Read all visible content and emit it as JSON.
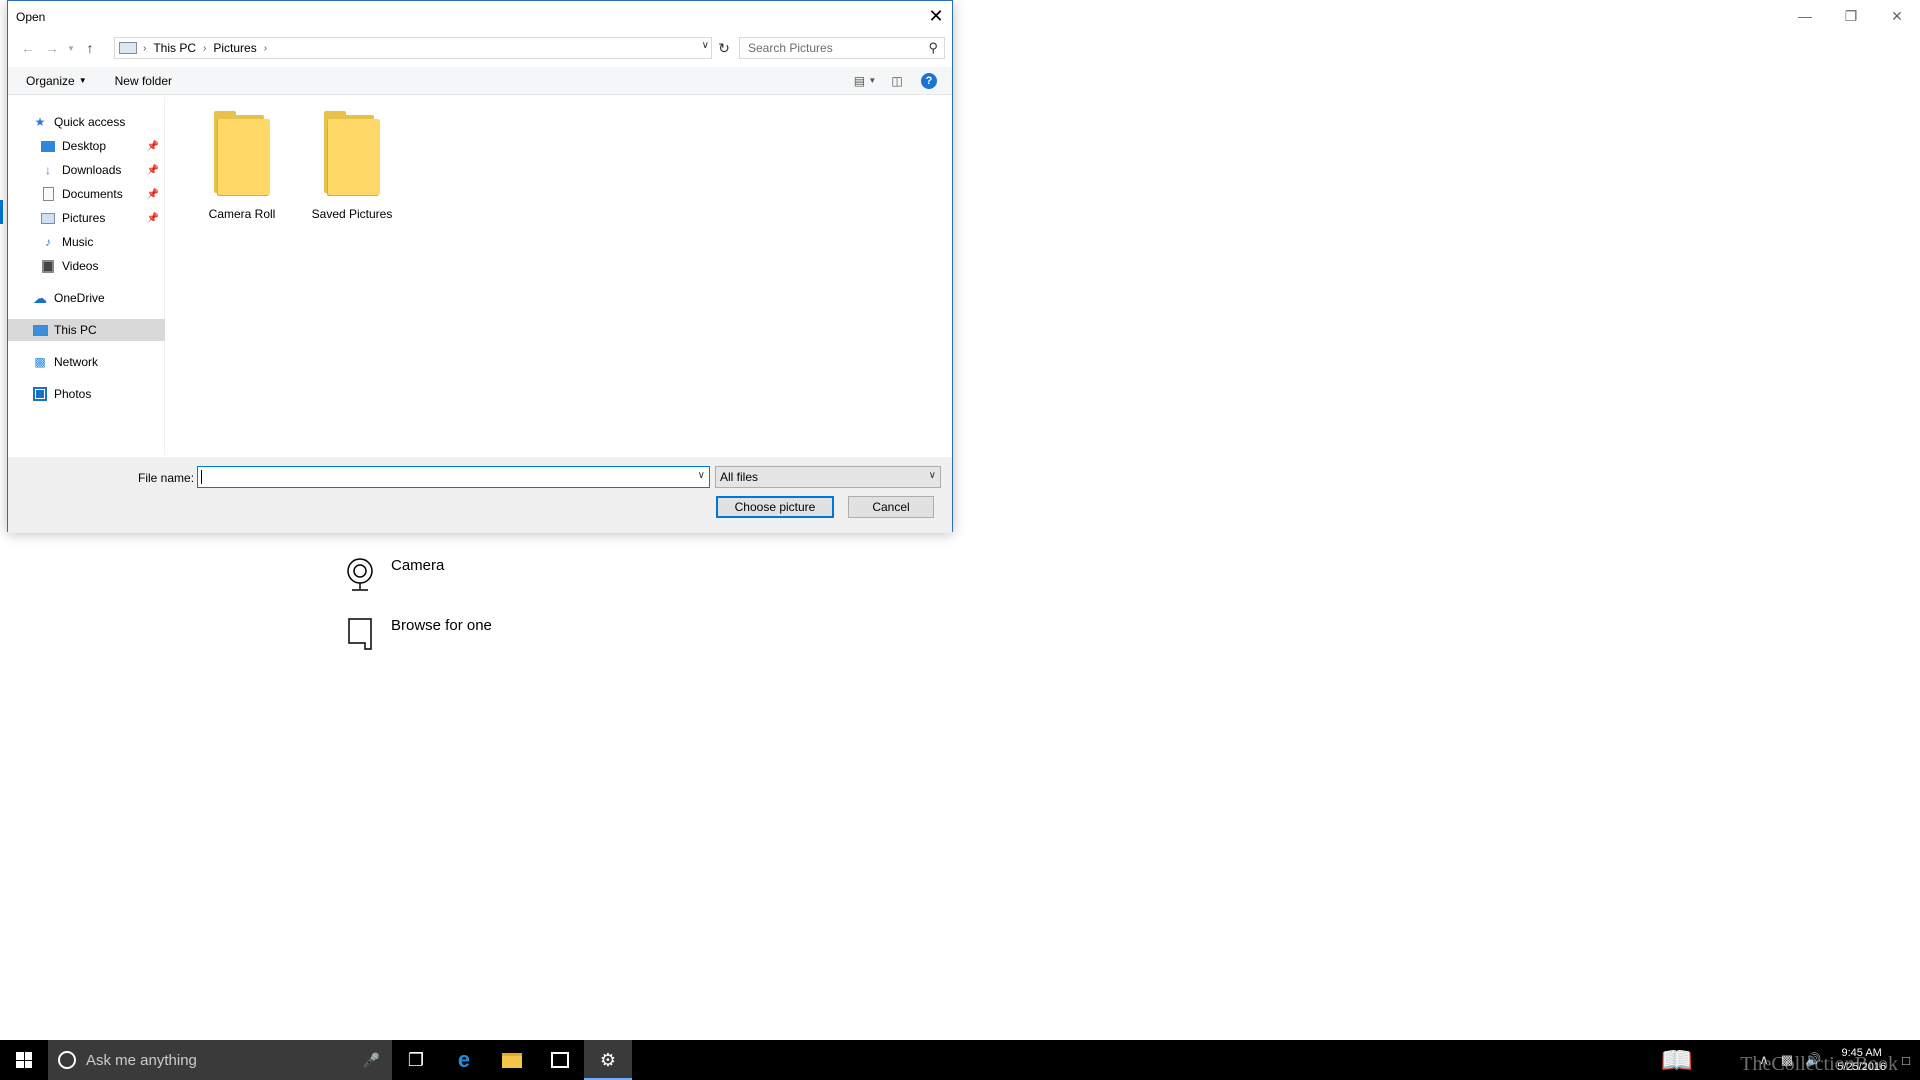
{
  "background_window": {
    "options": [
      {
        "label": "Camera",
        "icon": "camera-icon"
      },
      {
        "label": "Browse for one",
        "icon": "file-icon"
      }
    ]
  },
  "dialog": {
    "title": "Open",
    "address": {
      "crumbs": [
        "This PC",
        "Pictures"
      ]
    },
    "search_placeholder": "Search Pictures",
    "toolbar": {
      "organize": "Organize",
      "new_folder": "New folder",
      "help": "?"
    },
    "nav": {
      "quick_access": "Quick access",
      "quick_items": [
        {
          "label": "Desktop",
          "pinned": true
        },
        {
          "label": "Downloads",
          "pinned": true
        },
        {
          "label": "Documents",
          "pinned": true
        },
        {
          "label": "Pictures",
          "pinned": true
        },
        {
          "label": "Music",
          "pinned": false
        },
        {
          "label": "Videos",
          "pinned": false
        }
      ],
      "onedrive": "OneDrive",
      "this_pc": "This PC",
      "network": "Network",
      "photos": "Photos"
    },
    "folders": [
      {
        "name": "Camera Roll"
      },
      {
        "name": "Saved Pictures"
      }
    ],
    "file_name_label": "File name:",
    "file_name_value": "",
    "file_type": "All files",
    "buttons": {
      "choose": "Choose picture",
      "cancel": "Cancel"
    }
  },
  "taskbar": {
    "search_placeholder": "Ask me anything",
    "time": "9:45 AM",
    "date": "5/25/2016",
    "watermark": "TheCollectionBook"
  },
  "colors": {
    "accent": "#0078d7",
    "folder": "#ffd868",
    "taskbar": "#000000"
  }
}
